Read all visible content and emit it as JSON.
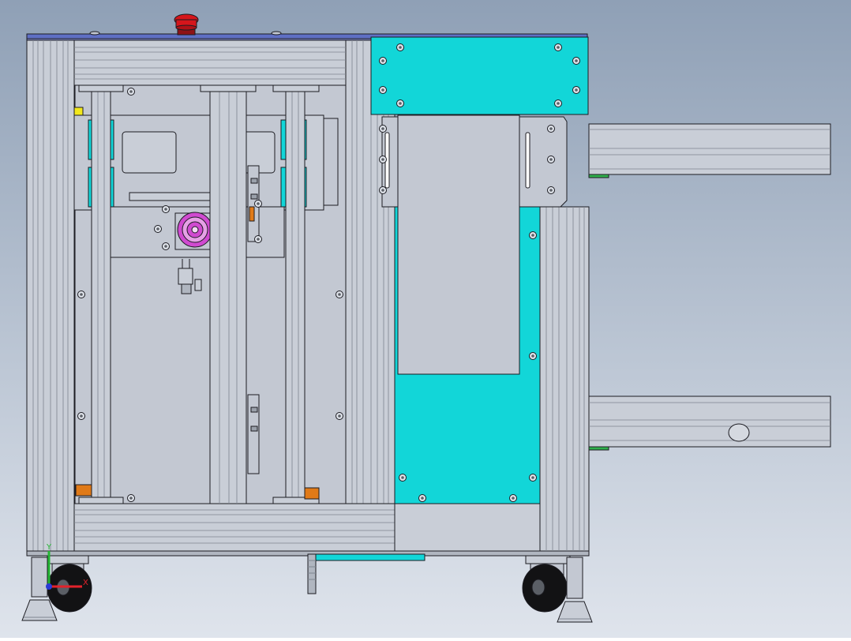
{
  "viewport": {
    "background_top": "#8fa0b6",
    "background_bottom": "#dfe4ec"
  },
  "colors": {
    "frame_profile": "#c9ced7",
    "frame_profile_dark": "#b0b6c0",
    "panel": "#c3c8d2",
    "panel_cyan": "#12d6d8",
    "top_plate": "#5f6fc4",
    "outline": "#1c1c22",
    "estop_red": "#d5151b",
    "marker_yellow": "#f2e81c",
    "spacer_orange": "#e07a18",
    "motor_magenta": "#d04ad0",
    "green_strip": "#2fb04c"
  },
  "axis_triad": {
    "x_label": "X",
    "y_label": "Y",
    "x_color": "#e3222b",
    "y_color": "#24b534",
    "z_color": "#2b3bd6"
  },
  "components": [
    "main-frame",
    "top-plate",
    "emergency-stop-button",
    "lift-drive-assembly",
    "cyan-cover-panel",
    "side-conveyor-rails",
    "caster-wheels",
    "leveling-feet"
  ]
}
